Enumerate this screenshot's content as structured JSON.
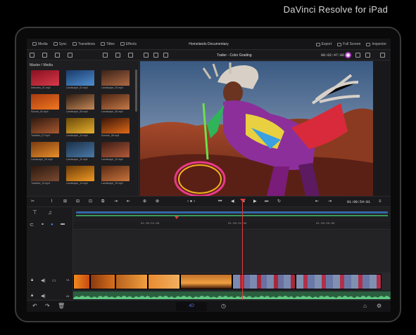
{
  "caption": "DaVinci Resolve for iPad",
  "topbar": {
    "title": "Homelands Documentary",
    "left_items": [
      {
        "label": "Media",
        "icon": "media-icon"
      },
      {
        "label": "Sync",
        "icon": "sync-icon"
      },
      {
        "label": "Transitions",
        "icon": "transitions-icon"
      },
      {
        "label": "Titles",
        "icon": "titles-icon"
      },
      {
        "label": "Effects",
        "icon": "effects-icon"
      }
    ],
    "right_items": [
      {
        "label": "Export",
        "icon": "export-icon"
      },
      {
        "label": "Full Screen",
        "icon": "fullscreen-icon"
      },
      {
        "label": "Inspector",
        "icon": "inspector-icon"
      }
    ]
  },
  "toolbar2": {
    "clip_title": "Trailer - Color Grading",
    "timecode": "00:02:47:06"
  },
  "media_pool": {
    "path": "Master / Media",
    "clips": [
      {
        "name": "Interview_01.mp4",
        "colors": [
          "#8a1020",
          "#d83a4a"
        ]
      },
      {
        "name": "Landscape_02.mp4",
        "colors": [
          "#1a3a6a",
          "#4f8fd0"
        ]
      },
      {
        "name": "Landscape_03.mp4",
        "colors": [
          "#3a2218",
          "#b06a44"
        ]
      },
      {
        "name": "Sunset_04.mp4",
        "colors": [
          "#a83a10",
          "#f07820"
        ]
      },
      {
        "name": "Landscape_05.mp4",
        "colors": [
          "#2a1a10",
          "#c88a58"
        ]
      },
      {
        "name": "Landscape_06.mp4",
        "colors": [
          "#4a2412",
          "#c67a48"
        ]
      },
      {
        "name": "Tradition_07.mp4",
        "colors": [
          "#301810",
          "#a85a30"
        ]
      },
      {
        "name": "Landscape_10.mp4",
        "colors": [
          "#6a4a08",
          "#e8b030"
        ]
      },
      {
        "name": "Sunrise_08.mp4",
        "colors": [
          "#3a1608",
          "#e06a18"
        ]
      },
      {
        "name": "Landscape_09.mp4",
        "colors": [
          "#7a3a10",
          "#e8902a"
        ]
      },
      {
        "name": "Landscape_11.mp4",
        "colors": [
          "#1a3048",
          "#4a7aa8"
        ]
      },
      {
        "name": "Landscape_12.mp4",
        "colors": [
          "#3a1c14",
          "#b45a3a"
        ]
      },
      {
        "name": "Tradition_13.mp4",
        "colors": [
          "#2a1810",
          "#7a4a30"
        ]
      },
      {
        "name": "Landscape_14.mp4",
        "colors": [
          "#6a3a08",
          "#f09a24"
        ]
      },
      {
        "name": "Landscape_15.mp4",
        "colors": [
          "#5a2a14",
          "#c8743c"
        ]
      }
    ]
  },
  "transport": {
    "zoom_label": "‹ ● ›",
    "timecode": "01:00:54:01"
  },
  "timeline": {
    "ruler": [
      "01:00:52:00",
      "01:00:54:00",
      "01:00:56:00"
    ],
    "video_track_label": "V1",
    "audio_track_label": "A1"
  },
  "bottombar": {
    "center_logo": "4D"
  },
  "colors": {
    "playhead": "#e23b3b",
    "accent": "#3566a8",
    "audio": "#2b5e3f"
  }
}
